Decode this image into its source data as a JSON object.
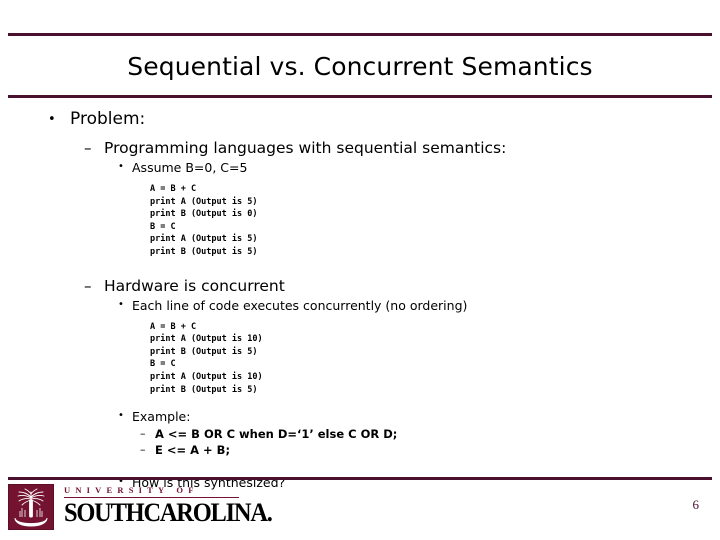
{
  "slide": {
    "title": "Sequential vs. Concurrent Semantics",
    "number": "6",
    "accent_color": "#4a1030",
    "logo_color": "#73132f"
  },
  "content": {
    "problem": "Problem:",
    "seq_heading": "Programming languages with sequential semantics:",
    "assume": "Assume B=0, C=5",
    "seq_code": "A = B + C\nprint A (Output is 5)\nprint B (Output is 0)\nB = C\nprint A (Output is 5)\nprint B (Output is 5)",
    "hw_heading": "Hardware is concurrent",
    "each_line": "Each line of code executes concurrently (no ordering)",
    "conc_code": "A = B + C\nprint A (Output is 10)\nprint B (Output is 5)\nB = C\nprint A (Output is 10)\nprint B (Output is 5)",
    "example": "Example:",
    "example_line1": "A <= B OR C when D=‘1’ else C OR D;",
    "example_line2": "E <= A + B;",
    "question": "How is this synthesized?"
  },
  "bullets": {
    "dot": "•",
    "dash": "–"
  },
  "logo": {
    "university": "UNIVERSITY OF",
    "name": "SOUTHCAROLINA.",
    "emblem": "palmetto-tree-crescent"
  }
}
